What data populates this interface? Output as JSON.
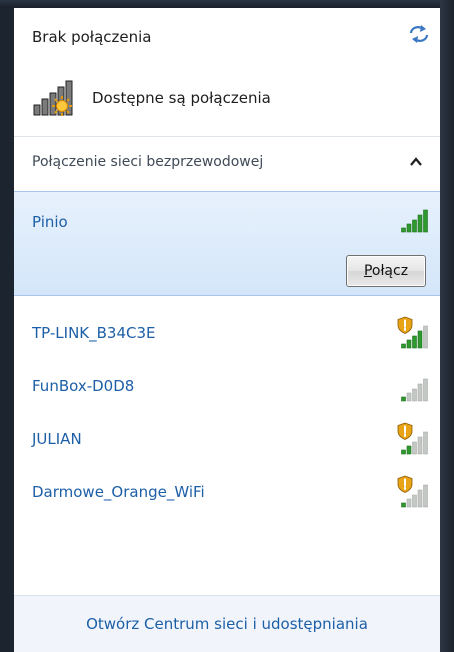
{
  "status": {
    "text": "Brak połączenia"
  },
  "available": {
    "text": "Dostępne są połączenia"
  },
  "section": {
    "label": "Połączenie sieci bezprzewodowej"
  },
  "selected_network": {
    "name": "Pinio",
    "connect_label": "Połącz",
    "signal": 5,
    "secured": false
  },
  "networks": [
    {
      "name": "TP-LINK_B34C3E",
      "signal": 4,
      "secured": true
    },
    {
      "name": "FunBox-D0D8",
      "signal": 1,
      "secured": false
    },
    {
      "name": "JULIAN",
      "signal": 2,
      "secured": true
    },
    {
      "name": "Darmowe_Orange_WiFi",
      "signal": 1,
      "secured": true
    }
  ],
  "footer": {
    "link": "Otwórz Centrum sieci i udostępniania"
  },
  "colors": {
    "link": "#1d5fa7",
    "signal_on": "#2e9a2e",
    "signal_off": "#c4c8c4",
    "selection_bg": "#dbe9f9",
    "shield": "#e8a317"
  }
}
